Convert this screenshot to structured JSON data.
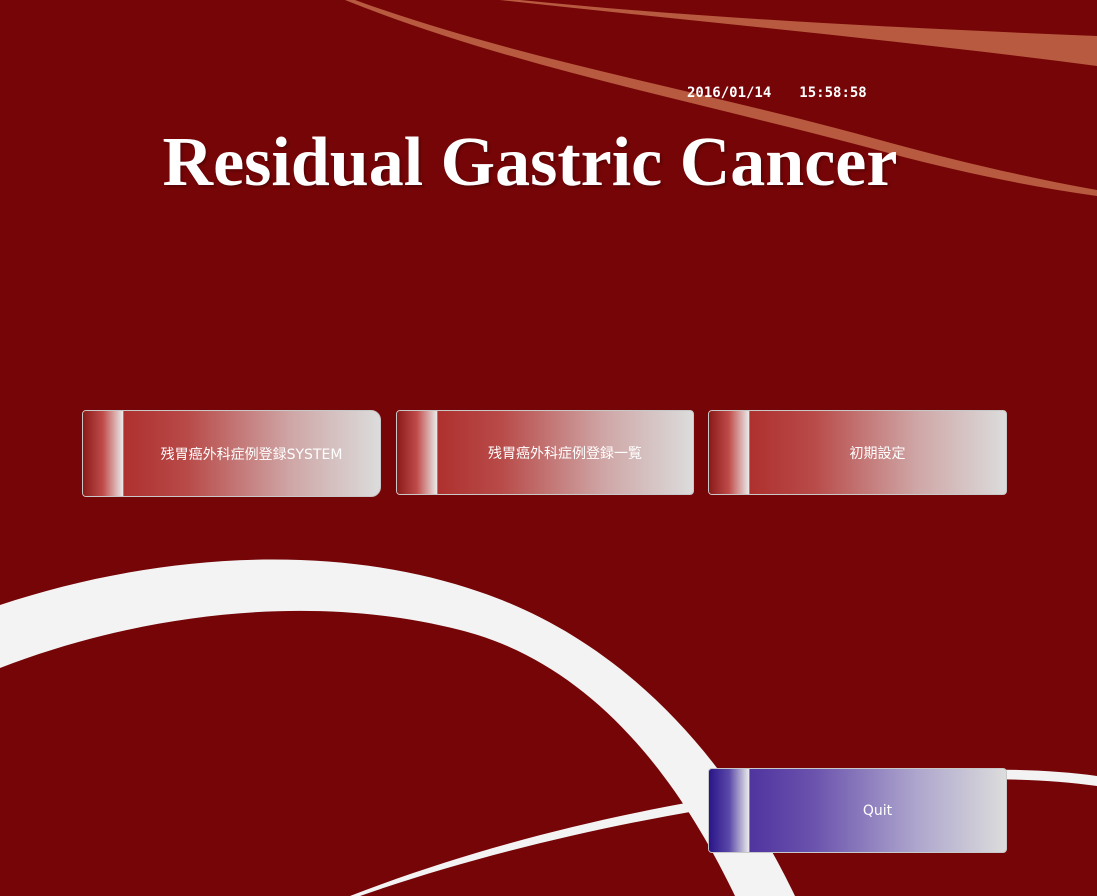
{
  "header": {
    "date": "2016/01/14",
    "time": "15:58:58",
    "title": "Residual Gastric Cancer"
  },
  "menu": {
    "system_label": "残胃癌外科症例登録SYSTEM",
    "list_label": "残胃癌外科症例登録一覧",
    "settings_label": "初期設定",
    "quit_label": "Quit"
  },
  "colors": {
    "background": "#760507",
    "accent_orange": "#b85a40",
    "swoosh_white": "#f3f3f3",
    "button_red": "#a8201e",
    "button_blue": "#3f2196"
  }
}
